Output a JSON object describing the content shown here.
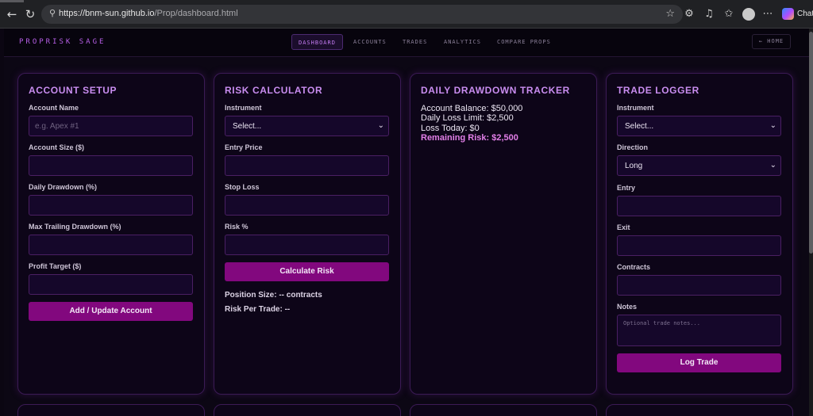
{
  "browser": {
    "url_host": "https://bnm-sun.github.io",
    "url_path": "/Prop/dashboard.html",
    "chat_label": "Chat"
  },
  "site": {
    "brand": "PROPRISK SAGE",
    "nav": [
      {
        "label": "DASHBOARD",
        "active": true
      },
      {
        "label": "ACCOUNTS",
        "active": false
      },
      {
        "label": "TRADES",
        "active": false
      },
      {
        "label": "ANALYTICS",
        "active": false
      },
      {
        "label": "COMPARE PROPS",
        "active": false
      }
    ],
    "home_label": "← HOME"
  },
  "account_setup": {
    "title": "ACCOUNT SETUP",
    "account_name": {
      "label": "Account Name",
      "placeholder": "e.g. Apex #1",
      "value": ""
    },
    "account_size": {
      "label": "Account Size ($)",
      "value": ""
    },
    "daily_drawdown": {
      "label": "Daily Drawdown (%)",
      "value": ""
    },
    "max_trailing": {
      "label": "Max Trailing Drawdown (%)",
      "value": ""
    },
    "profit_target": {
      "label": "Profit Target ($)",
      "value": ""
    },
    "submit_label": "Add / Update Account"
  },
  "risk_calculator": {
    "title": "RISK CALCULATOR",
    "instrument": {
      "label": "Instrument",
      "selected": "Select..."
    },
    "entry_price": {
      "label": "Entry Price",
      "value": ""
    },
    "stop_loss": {
      "label": "Stop Loss",
      "value": ""
    },
    "risk_pct": {
      "label": "Risk %",
      "value": ""
    },
    "calculate_label": "Calculate Risk",
    "position_size": "Position Size: -- contracts",
    "risk_per_trade": "Risk Per Trade: --"
  },
  "drawdown_tracker": {
    "title": "DAILY DRAWDOWN TRACKER",
    "account_balance": "Account Balance: $50,000",
    "daily_loss_limit": "Daily Loss Limit: $2,500",
    "loss_today": "Loss Today: $0",
    "remaining_risk": "Remaining Risk: $2,500"
  },
  "trade_logger": {
    "title": "TRADE LOGGER",
    "instrument": {
      "label": "Instrument",
      "selected": "Select..."
    },
    "direction": {
      "label": "Direction",
      "selected": "Long"
    },
    "entry": {
      "label": "Entry",
      "value": ""
    },
    "exit": {
      "label": "Exit",
      "value": ""
    },
    "contracts": {
      "label": "Contracts",
      "value": ""
    },
    "notes": {
      "label": "Notes",
      "placeholder": "Optional trade notes..."
    },
    "submit_label": "Log Trade"
  },
  "colors": {
    "accent": "#c98df0",
    "button": "#82087e",
    "highlight": "#e27fe8",
    "background": "#0c0714"
  }
}
